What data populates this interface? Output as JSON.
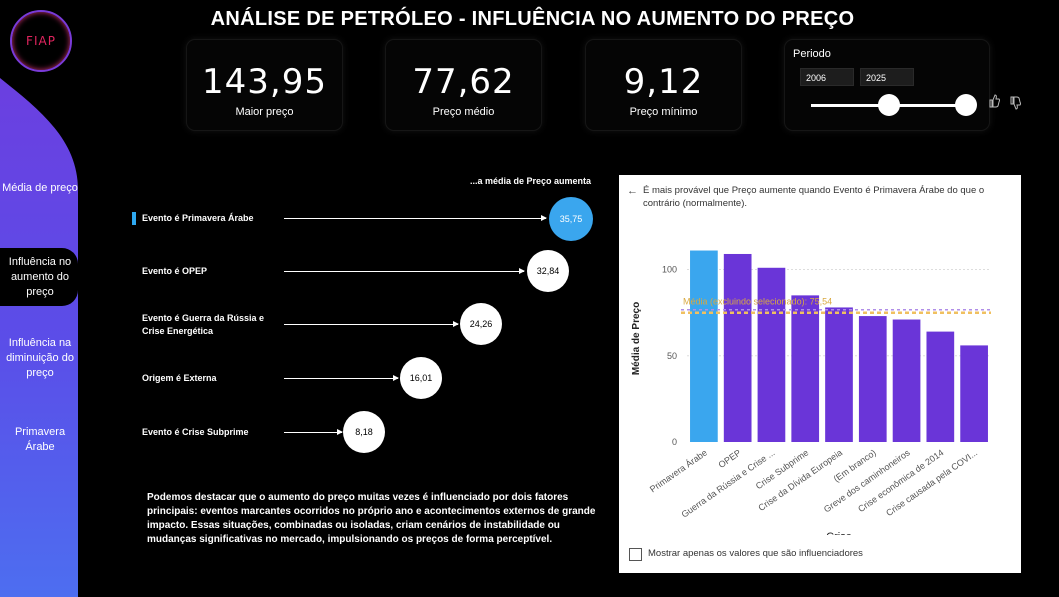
{
  "logo": {
    "text": "FIAP"
  },
  "title": "ANÁLISE DE PETRÓLEO - INFLUÊNCIA NO AUMENTO DO PREÇO",
  "nav": [
    {
      "label": "Média de preço",
      "active": false
    },
    {
      "label": "Influência no aumento do preço",
      "active": true
    },
    {
      "label": "Influência na diminuição do preço",
      "active": false
    },
    {
      "label": "Primavera Árabe",
      "active": false
    }
  ],
  "kpis": [
    {
      "value": "143,95",
      "label": "Maior preço"
    },
    {
      "value": "77,62",
      "label": "Preço médio"
    },
    {
      "value": "9,12",
      "label": "Preço mínimo"
    }
  ],
  "period": {
    "title": "Periodo",
    "from": "2006",
    "to": "2025"
  },
  "influencers": {
    "header": "...a média de Preço aumenta",
    "items": [
      {
        "label": "Evento é Primavera Árabe",
        "value": "35,75",
        "selected": true
      },
      {
        "label": "Evento é OPEP",
        "value": "32,84",
        "selected": false
      },
      {
        "label": "Evento é Guerra da Rússia e Crise Energética",
        "value": "24,26",
        "selected": false
      },
      {
        "label": "Origem é Externa",
        "value": "16,01",
        "selected": false
      },
      {
        "label": "Evento é Crise Subprime",
        "value": "8,18",
        "selected": false
      }
    ]
  },
  "paragraph": "Podemos destacar que o aumento do preço muitas vezes é influenciado por dois fatores principais: eventos marcantes ocorridos no próprio ano e acontecimentos externos de grande impacto. Essas situações, combinadas ou isoladas, criam cenários de instabilidade ou mudanças significativas no mercado, impulsionando os preços de forma perceptível.",
  "panel": {
    "description": "É mais provável que Preço aumente quando Evento é Primavera Árabe do que o contrário (normalmente).",
    "checkbox_label": "Mostrar apenas os valores que são influenciadores"
  },
  "colors": {
    "highlight": "#3aa6ee",
    "bar": "#6a35d8",
    "avg_line": "#f0c060"
  },
  "chart_data": {
    "type": "bar",
    "title": "",
    "xlabel": "Crise",
    "ylabel": "Média de Preço",
    "ylim": [
      0,
      120
    ],
    "yticks": [
      0,
      50,
      100
    ],
    "grid": true,
    "categories": [
      "Primavera Árabe",
      "OPEP",
      "Guerra da Rússia e Crise ...",
      "Crise Subprime",
      "Crise da Dívida Europeia",
      "(Em branco)",
      "Greve dos caminhoneiros",
      "Crise econômica de 2014",
      "Crise causada pela COVI..."
    ],
    "series": [
      {
        "values": [
          111,
          109,
          101,
          85,
          78,
          73,
          71,
          64,
          56
        ]
      }
    ],
    "highlight_index": 0,
    "average_line": {
      "label": "Média (excluindo selecionado): 75,54",
      "value": 75.54
    }
  }
}
